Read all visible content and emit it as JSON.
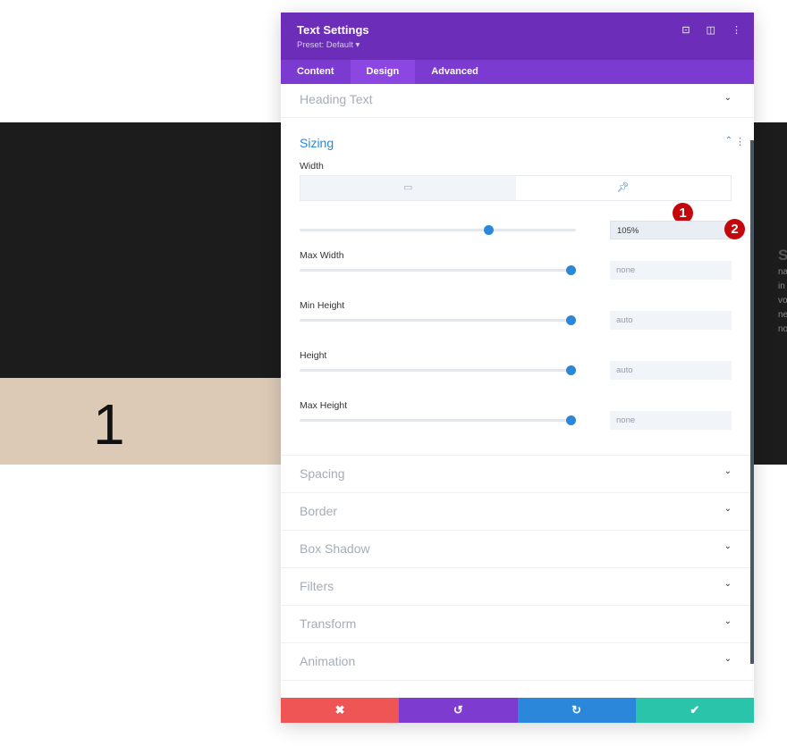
{
  "background": {
    "number": "1",
    "text_lines": [
      "S",
      "na",
      "in",
      "vo",
      "ne",
      "no"
    ]
  },
  "panel": {
    "title": "Text Settings",
    "preset": "Preset: Default ▾",
    "header_icons": [
      "focus-icon",
      "split-view-icon",
      "more-icon"
    ],
    "tabs": [
      {
        "label": "Content"
      },
      {
        "label": "Design",
        "active": true
      },
      {
        "label": "Advanced"
      }
    ],
    "sections_top": [
      {
        "label": "Heading Text"
      }
    ],
    "sizing": {
      "label": "Sizing",
      "width_label": "Width",
      "width_value": "105%",
      "width_slider": 0.69,
      "fields": [
        {
          "label": "Max Width",
          "value": "none",
          "slider": 1.0
        },
        {
          "label": "Min Height",
          "value": "auto",
          "slider": 1.0
        },
        {
          "label": "Height",
          "value": "auto",
          "slider": 1.0
        },
        {
          "label": "Max Height",
          "value": "none",
          "slider": 1.0
        }
      ]
    },
    "sections_bottom": [
      {
        "label": "Spacing"
      },
      {
        "label": "Border"
      },
      {
        "label": "Box Shadow"
      },
      {
        "label": "Filters"
      },
      {
        "label": "Transform"
      },
      {
        "label": "Animation"
      }
    ],
    "badges": [
      "1",
      "2"
    ],
    "footer": {
      "cancel": "✖",
      "undo": "↺",
      "redo": "↻",
      "save": "✔"
    },
    "colors": {
      "header": "#6c2eb9",
      "tabs": "#7b3ad0",
      "accent": "#2b87da",
      "cancel": "#ef5555",
      "undo": "#7e3bd0",
      "redo": "#2b87da",
      "save": "#29c4a9"
    }
  }
}
